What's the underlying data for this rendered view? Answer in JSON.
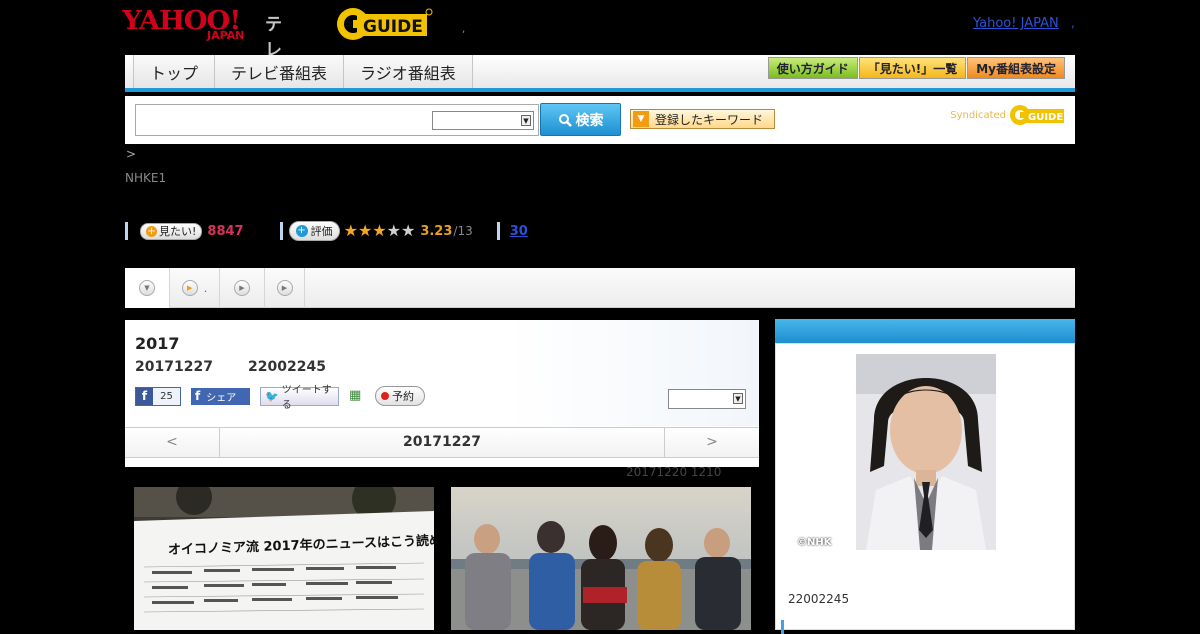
{
  "header": {
    "logo_yahoo": "YAHOO!",
    "logo_japan": "JAPAN",
    "logo_tv": "テレビ",
    "gguide_logo": "G-GUIDE",
    "yahoo_japan_link": "Yahoo! JAPAN"
  },
  "nav": {
    "tabs": [
      "トップ",
      "テレビ番組表",
      "ラジオ番組表"
    ],
    "buttons": [
      "使い方ガイド",
      "「見たい!」一覧",
      "My番組表設定"
    ]
  },
  "search": {
    "input_value": "",
    "select_value": "",
    "button_label": "検索",
    "keyword_button_label": "登録したキーワード",
    "syndicated_label": "Syndicated"
  },
  "breadcrumb": {
    "text": ">"
  },
  "channel": {
    "name": "NHKE1"
  },
  "stats": {
    "mitai_label": "見たい!",
    "mitai_count": "8847",
    "eval_label": "評価",
    "rating": "3.23",
    "rating_count": "/13",
    "stars_filled": 3,
    "stars_total": 5,
    "reviews": "30"
  },
  "tabs_bar": {
    "tab2_text": "."
  },
  "program": {
    "title": "2017",
    "date": "20171227",
    "time": "22002245",
    "like_count": "25",
    "share_label": "シェア",
    "tweet_label": "ツイートする",
    "record_label": "予約",
    "pager_prev": "<",
    "pager_date": "20171227",
    "pager_next": ">",
    "updated": "20171220  1210"
  },
  "photos": {
    "photo1_caption": "オイコノミア流 2017年のニュースはこう読め!"
  },
  "sidebar": {
    "thumb_credit": "©NHK",
    "time": "22002245"
  },
  "colors": {
    "accent_blue": "#1e9ad6",
    "mitai_pink": "#d8315b",
    "rating_orange": "#e8a020",
    "link_blue": "#2a52d6"
  }
}
